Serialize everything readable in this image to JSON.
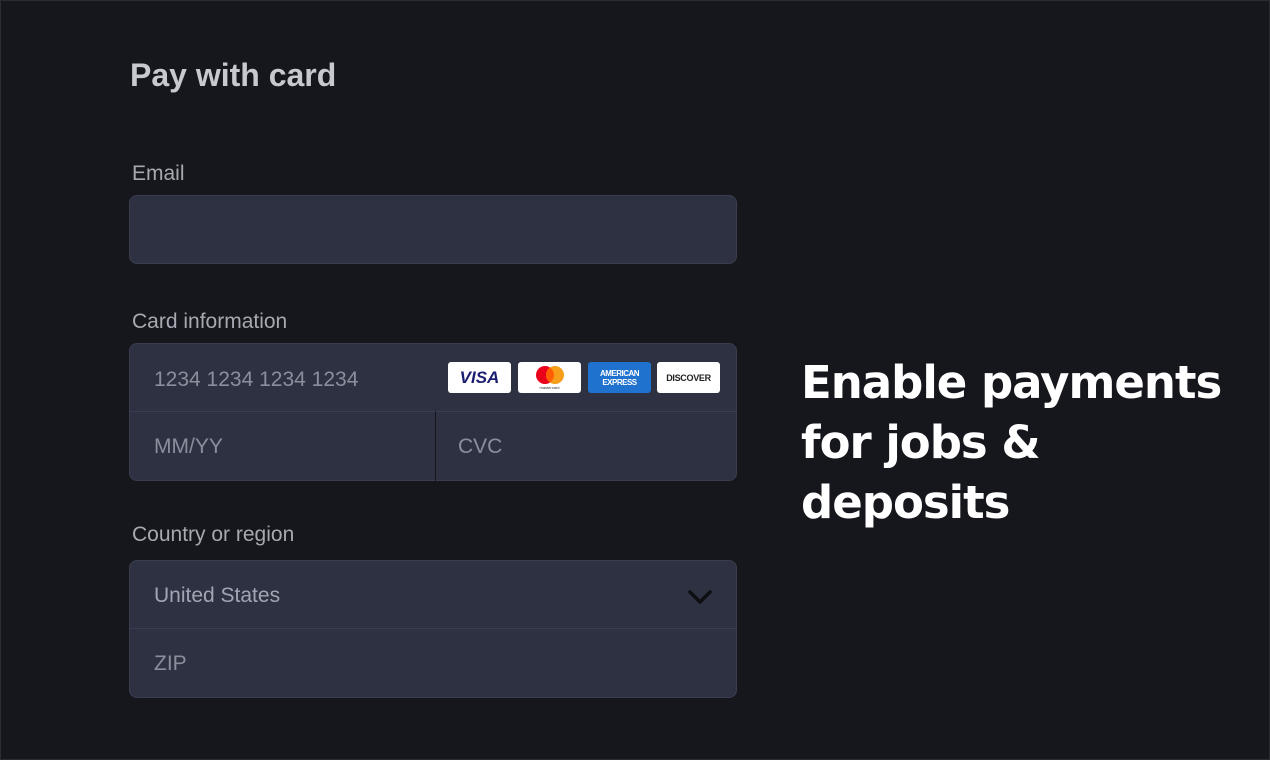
{
  "heading": "Pay with card",
  "email": {
    "label": "Email",
    "value": ""
  },
  "card": {
    "label": "Card information",
    "number_placeholder": "1234 1234 1234 1234",
    "expiry_placeholder": "MM/YY",
    "cvc_placeholder": "CVC",
    "brands": [
      {
        "name": "visa",
        "text": "VISA"
      },
      {
        "name": "mastercard",
        "text": "mastercard"
      },
      {
        "name": "amex",
        "line1": "AMERICAN",
        "line2": "EXPRESS"
      },
      {
        "name": "discover",
        "text": "DISCOVER"
      }
    ]
  },
  "country": {
    "label": "Country or region",
    "selected": "United States",
    "zip_placeholder": "ZIP"
  },
  "tagline": {
    "line1": "Enable payments",
    "line2": "for jobs & deposits"
  },
  "colors": {
    "background": "#16171c",
    "field": "#2e3142",
    "amex": "#1f72cd",
    "visa": "#1a1f71"
  }
}
